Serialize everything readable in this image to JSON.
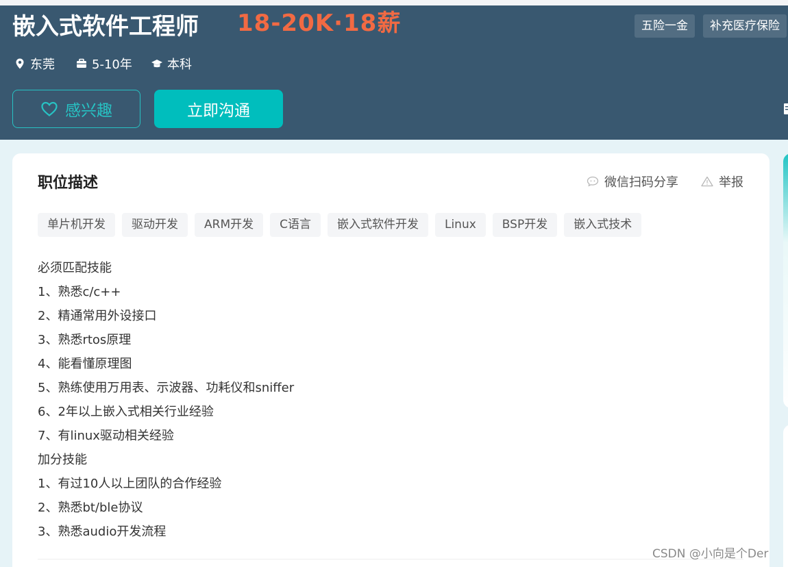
{
  "header": {
    "job_title": "嵌入式软件工程师",
    "salary": "18-20K·18薪",
    "benefits": [
      "五险一金",
      "补充医疗保险"
    ],
    "meta": {
      "city": "东莞",
      "experience": "5-10年",
      "degree": "本科"
    },
    "interest_label": "感兴趣",
    "chat_label": "立即沟通"
  },
  "job_desc": {
    "title": "职位描述",
    "share_label": "微信扫码分享",
    "report_label": "举报",
    "tags": [
      "单片机开发",
      "驱动开发",
      "ARM开发",
      "C语言",
      "嵌入式软件开发",
      "Linux",
      "BSP开发",
      "嵌入式技术"
    ],
    "lines": [
      "必须匹配技能",
      "1、熟悉c/c++",
      "2、精通常用外设接口",
      "3、熟悉rtos原理",
      "4、能看懂原理图",
      "5、熟练使用万用表、示波器、功耗仪和sniffer",
      "6、2年以上嵌入式相关行业经验",
      "7、有linux驱动相关经验",
      "加分技能",
      "1、有过10人以上团队的合作经验",
      "2、熟悉bt/ble协议",
      "3、熟悉audio开发流程"
    ]
  },
  "watermark": "CSDN @小向是个Der",
  "colors": {
    "header_bg": "#395870",
    "salary": "#f26a43",
    "accent": "#00bebd"
  }
}
